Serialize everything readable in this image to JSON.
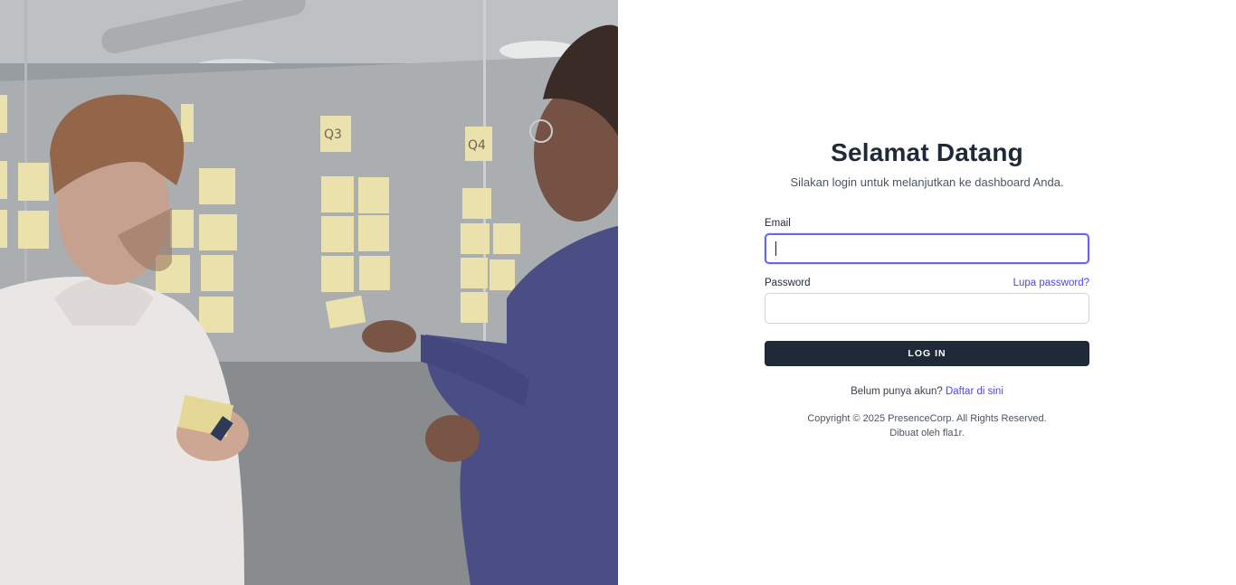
{
  "form": {
    "title": "Selamat Datang",
    "subtitle": "Silakan login untuk melanjutkan ke dashboard Anda.",
    "email_label": "Email",
    "email_value": "",
    "password_label": "Password",
    "password_value": "",
    "forgot_link": "Lupa password?",
    "login_button": "LOG IN",
    "signup_prompt": "Belum punya akun?",
    "signup_link": "Daftar di sini"
  },
  "footer": {
    "copyright": "Copyright © 2025 PresenceCorp. All Rights Reserved.",
    "credit": "Dibuat oleh fla1r."
  },
  "hero_image": {
    "sticky_notes": {
      "q3_header": "Q3",
      "q4_header": "Q4"
    }
  },
  "colors": {
    "accent": "#4f46e5",
    "focus_ring": "#6366f1",
    "button_bg": "#1f2937",
    "heading": "#1f2937"
  }
}
